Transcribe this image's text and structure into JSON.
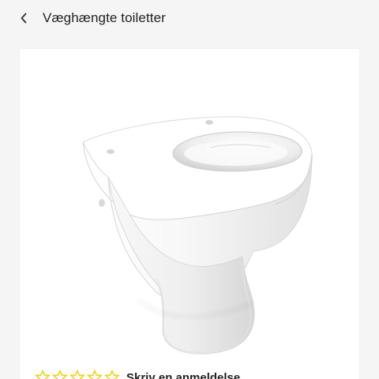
{
  "header": {
    "back_icon": "chevron-left-icon",
    "title": "Væghængte toiletter"
  },
  "product": {
    "image_icon": "wall-hung-toilet-image"
  },
  "rating": {
    "stars_total": 5,
    "star_color": "#f2d21b",
    "label": "Skriv en anmeldelse"
  },
  "colors": {
    "background": "#f5f5f5",
    "card": "#ffffff",
    "text": "#222222"
  }
}
